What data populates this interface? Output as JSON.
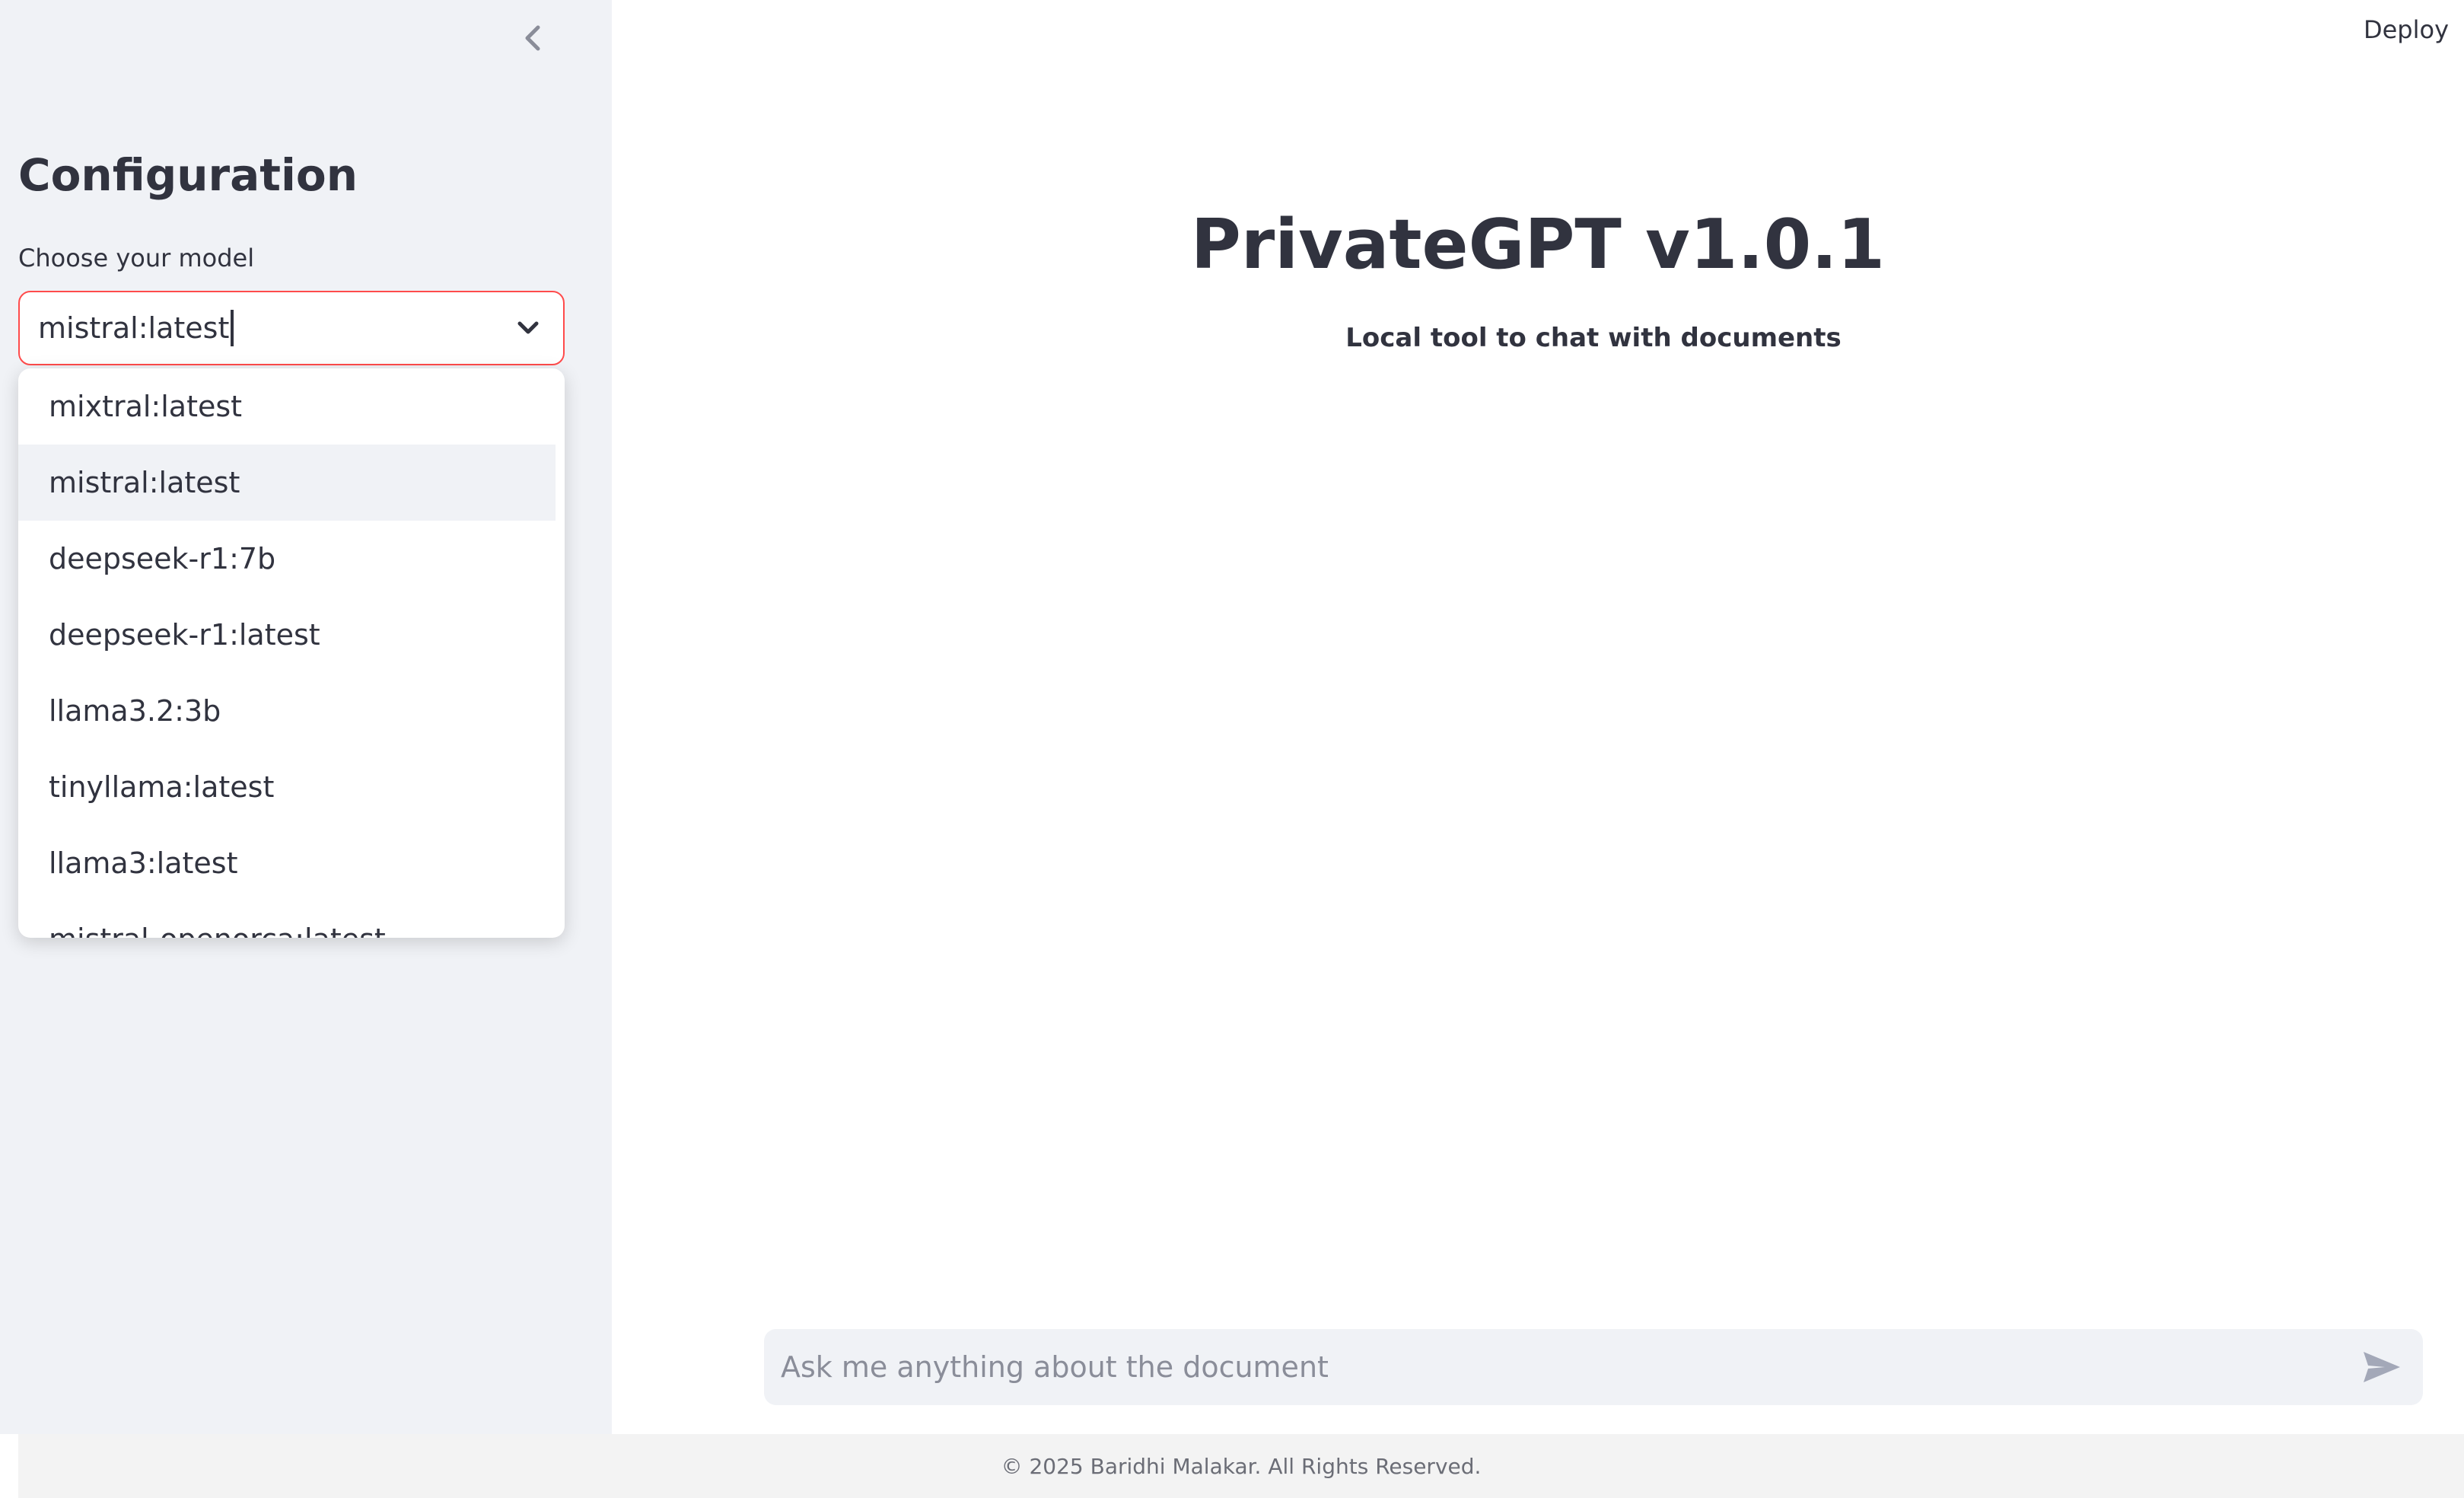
{
  "sidebar": {
    "title": "Configuration",
    "model_select": {
      "label": "Choose your model",
      "value": "mistral:latest",
      "options": [
        "mixtral:latest",
        "mistral:latest",
        "deepseek-r1:7b",
        "deepseek-r1:latest",
        "llama3.2:3b",
        "tinyllama:latest",
        "llama3:latest",
        "mistral-openorca:latest"
      ],
      "highlighted": "mistral:latest"
    }
  },
  "header": {
    "deploy_label": "Deploy"
  },
  "main": {
    "title": "PrivateGPT v1.0.1",
    "subtitle": "Local tool to chat with documents"
  },
  "chat": {
    "placeholder": "Ask me anything about the document"
  },
  "footer": {
    "text": "© 2025 Baridhi Malakar. All Rights Reserved."
  },
  "colors": {
    "accent": "#ff4b4b",
    "sidebar_bg": "#f0f2f6",
    "text": "#31333f"
  },
  "icons": {
    "collapse": "chevron-left-icon",
    "select": "chevron-down-icon",
    "send": "send-icon"
  }
}
